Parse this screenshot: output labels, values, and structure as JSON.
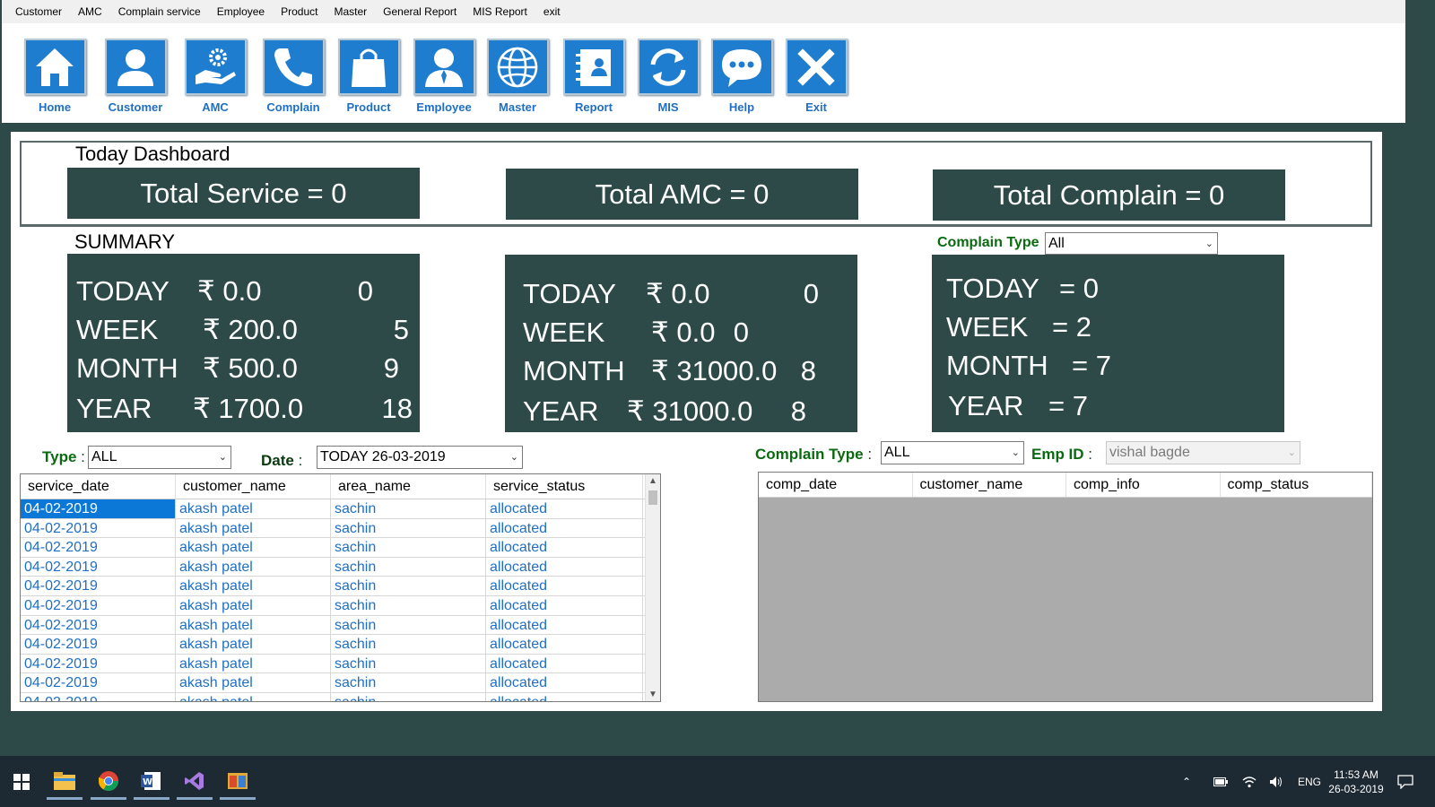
{
  "menu": [
    "Customer",
    "AMC",
    "Complain  service",
    "Employee",
    "Product",
    "Master",
    "General Report",
    "MIS Report",
    "exit"
  ],
  "toolbar": [
    {
      "label": "Home",
      "icon": "home-icon"
    },
    {
      "label": "Customer",
      "icon": "person-icon"
    },
    {
      "label": "AMC",
      "icon": "gear-hand-icon"
    },
    {
      "label": "Complain",
      "icon": "phone-icon"
    },
    {
      "label": "Product",
      "icon": "shopping-bag-icon"
    },
    {
      "label": "Employee",
      "icon": "employee-icon"
    },
    {
      "label": "Master",
      "icon": "globe-icon"
    },
    {
      "label": "Report",
      "icon": "contact-book-icon"
    },
    {
      "label": "MIS",
      "icon": "refresh-icon"
    },
    {
      "label": "Help",
      "icon": "chat-bubble-icon"
    },
    {
      "label": "Exit",
      "icon": "close-icon"
    }
  ],
  "dashboard": {
    "title": "Today Dashboard",
    "total_service": "Total Service =  0",
    "total_amc": "Total AMC =  0",
    "total_complain": "Total Complain = 0"
  },
  "summary": {
    "title": "SUMMARY",
    "complain_type_label": "Complain Type",
    "complain_type_value": "All",
    "service": [
      {
        "period": "TODAY",
        "amount": "₹ 0.0",
        "count": "0"
      },
      {
        "period": "WEEK",
        "amount": "₹ 200.0",
        "count": "5"
      },
      {
        "period": "MONTH",
        "amount": "₹ 500.0",
        "count": "9"
      },
      {
        "period": "YEAR",
        "amount": "₹ 1700.0",
        "count": "18"
      }
    ],
    "amc": [
      {
        "period": "TODAY",
        "amount": "₹ 0.0",
        "count": "0"
      },
      {
        "period": "WEEK",
        "amount": "₹ 0.0",
        "count": "0"
      },
      {
        "period": "MONTH",
        "amount": "₹ 31000.0",
        "count": "8"
      },
      {
        "period": "YEAR",
        "amount": "₹ 31000.0",
        "count": "8"
      }
    ],
    "complain": [
      {
        "period": "TODAY",
        "value": "= 0"
      },
      {
        "period": "WEEK",
        "value": "= 2"
      },
      {
        "period": "MONTH",
        "value": "= 7"
      },
      {
        "period": "YEAR",
        "value": "= 7"
      }
    ]
  },
  "filters": {
    "type_label": "Type",
    "type_value": "ALL",
    "date_label": "Date",
    "date_value": "TODAY 26-03-2019",
    "complain_type_label": "Complain Type",
    "complain_type_value": "ALL",
    "emp_id_label": "Emp ID",
    "emp_id_value": "vishal bagde"
  },
  "service_grid": {
    "columns": [
      "service_date",
      "customer_name",
      "area_name",
      "service_status"
    ],
    "rows": [
      [
        "04-02-2019",
        "akash patel",
        "sachin",
        "allocated"
      ],
      [
        "04-02-2019",
        "akash patel",
        "sachin",
        "allocated"
      ],
      [
        "04-02-2019",
        "akash patel",
        "sachin",
        "allocated"
      ],
      [
        "04-02-2019",
        "akash patel",
        "sachin",
        "allocated"
      ],
      [
        "04-02-2019",
        "akash patel",
        "sachin",
        "allocated"
      ],
      [
        "04-02-2019",
        "akash patel",
        "sachin",
        "allocated"
      ],
      [
        "04-02-2019",
        "akash patel",
        "sachin",
        "allocated"
      ],
      [
        "04-02-2019",
        "akash patel",
        "sachin",
        "allocated"
      ],
      [
        "04-02-2019",
        "akash patel",
        "sachin",
        "allocated"
      ],
      [
        "04-02-2019",
        "akash patel",
        "sachin",
        "allocated"
      ],
      [
        "04-02-2019",
        "akash patel",
        "sachin",
        "allocated"
      ]
    ]
  },
  "complain_grid": {
    "columns": [
      "comp_date",
      "customer_name",
      "comp_info",
      "comp_status"
    ]
  },
  "taskbar": {
    "lang": "ENG",
    "time": "11:53 AM",
    "date": "26-03-2019"
  }
}
